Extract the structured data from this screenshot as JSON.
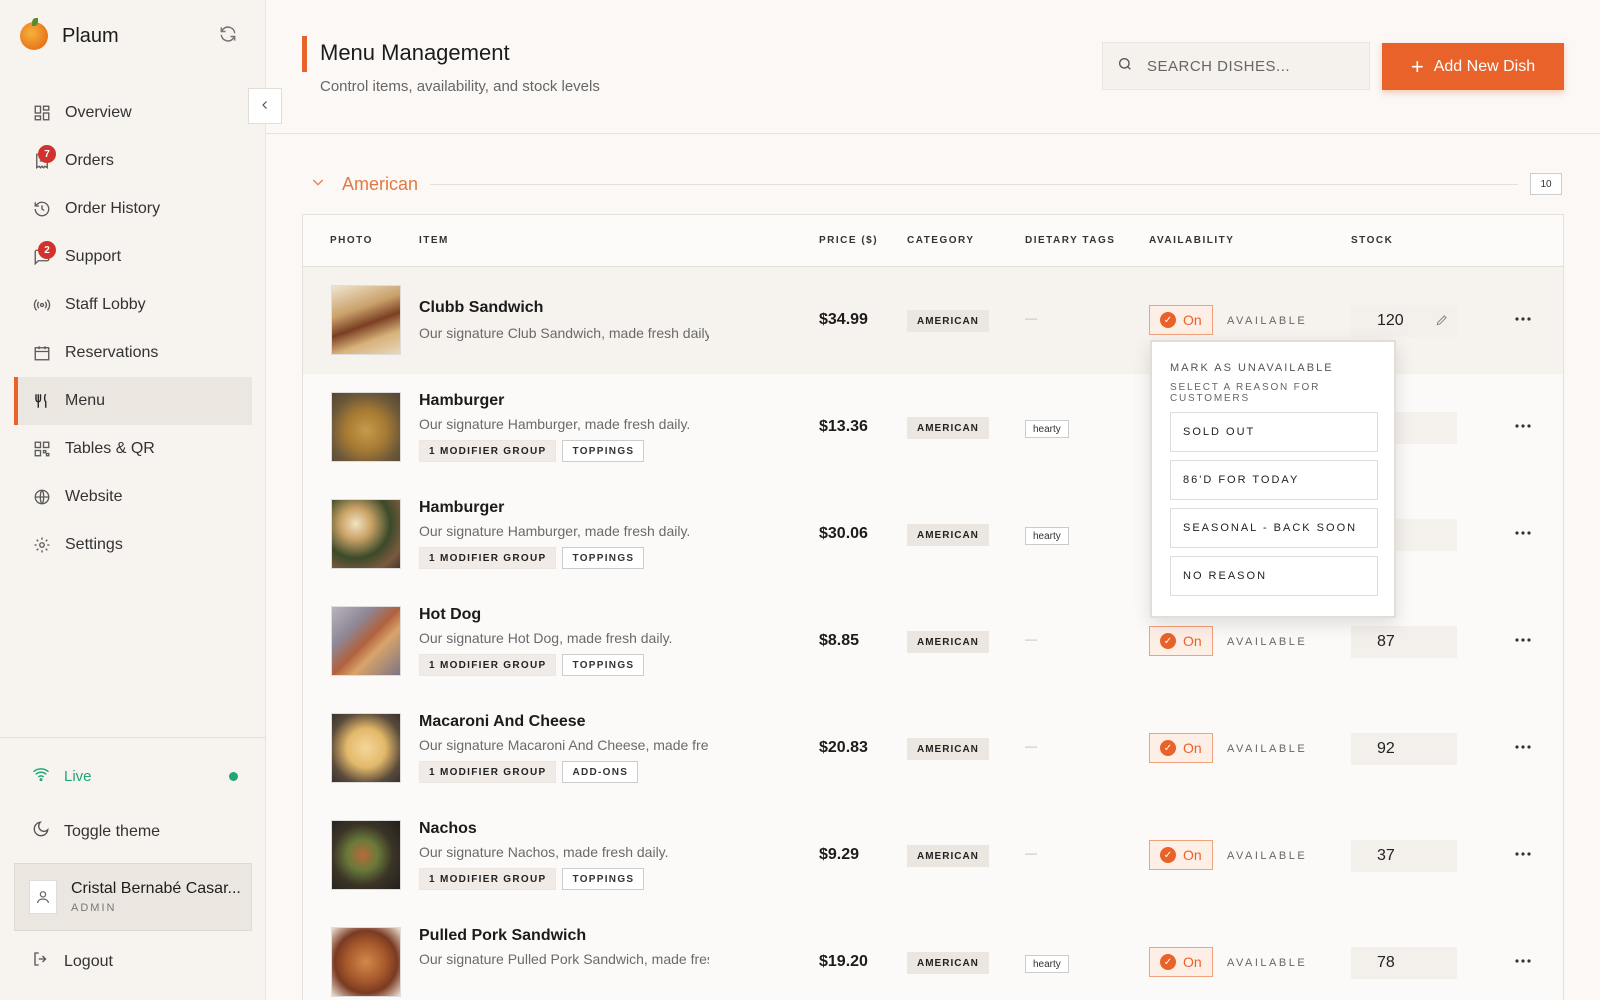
{
  "brand": {
    "name": "Plaum"
  },
  "nav": [
    {
      "label": "Overview",
      "icon": "grid-icon"
    },
    {
      "label": "Orders",
      "icon": "receipt-icon",
      "badge": "7"
    },
    {
      "label": "Order History",
      "icon": "history-icon"
    },
    {
      "label": "Support",
      "icon": "chat-icon",
      "badge": "2"
    },
    {
      "label": "Staff Lobby",
      "icon": "broadcast-icon"
    },
    {
      "label": "Reservations",
      "icon": "calendar-icon"
    },
    {
      "label": "Menu",
      "icon": "utensils-icon",
      "active": true
    },
    {
      "label": "Tables & QR",
      "icon": "qr-icon"
    },
    {
      "label": "Website",
      "icon": "globe-icon"
    },
    {
      "label": "Settings",
      "icon": "gear-icon"
    }
  ],
  "status": {
    "live_label": "Live",
    "live_color": "#1ea77a"
  },
  "theme": {
    "label": "Toggle theme"
  },
  "user": {
    "name": "Cristal Bernabé Casar...",
    "role": "ADMIN"
  },
  "logout": {
    "label": "Logout"
  },
  "header": {
    "title": "Menu Management",
    "subtitle": "Control items, availability, and stock levels",
    "search_placeholder": "SEARCH DISHES...",
    "add_button": "Add New Dish",
    "accent": "#e8622a"
  },
  "section": {
    "name": "American",
    "count": "10"
  },
  "columns": {
    "photo": "PHOTO",
    "item": "ITEM",
    "price": "PRICE ($)",
    "category": "CATEGORY",
    "dietary": "DIETARY TAGS",
    "availability": "AVAILABILITY",
    "stock": "STOCK"
  },
  "rows": [
    {
      "name": "Clubb Sandwich",
      "desc": "Our signature Club Sandwich, made fresh daily.",
      "price": "$34.99",
      "category": "AMERICAN",
      "dietary": "—",
      "toggle": "On",
      "availability": "AVAILABLE",
      "stock": "120",
      "modifiers": null,
      "addon": null
    },
    {
      "name": "Hamburger",
      "desc": "Our signature Hamburger, made fresh daily.",
      "price": "$13.36",
      "category": "AMERICAN",
      "dietary": "hearty",
      "modifiers": "1 MODIFIER GROUP",
      "addon": "TOPPINGS"
    },
    {
      "name": "Hamburger",
      "desc": "Our signature Hamburger, made fresh daily.",
      "price": "$30.06",
      "category": "AMERICAN",
      "dietary": "hearty",
      "modifiers": "1 MODIFIER GROUP",
      "addon": "TOPPINGS"
    },
    {
      "name": "Hot Dog",
      "desc": "Our signature Hot Dog, made fresh daily.",
      "price": "$8.85",
      "category": "AMERICAN",
      "dietary": "—",
      "toggle": "On",
      "availability": "AVAILABLE",
      "stock": "87",
      "modifiers": "1 MODIFIER GROUP",
      "addon": "TOPPINGS"
    },
    {
      "name": "Macaroni And Cheese",
      "desc": "Our signature Macaroni And Cheese, made fresh",
      "price": "$20.83",
      "category": "AMERICAN",
      "dietary": "—",
      "toggle": "On",
      "availability": "AVAILABLE",
      "stock": "92",
      "modifiers": "1 MODIFIER GROUP",
      "addon": "ADD-ONS"
    },
    {
      "name": "Nachos",
      "desc": "Our signature Nachos, made fresh daily.",
      "price": "$9.29",
      "category": "AMERICAN",
      "dietary": "—",
      "toggle": "On",
      "availability": "AVAILABLE",
      "stock": "37",
      "modifiers": "1 MODIFIER GROUP",
      "addon": "TOPPINGS"
    },
    {
      "name": "Pulled Pork Sandwich",
      "desc": "Our signature Pulled Pork Sandwich, made fresh d",
      "price": "$19.20",
      "category": "AMERICAN",
      "dietary": "hearty",
      "toggle": "On",
      "availability": "AVAILABLE",
      "stock": "78",
      "modifiers": null,
      "addon": null
    }
  ],
  "dropdown": {
    "title": "MARK AS UNAVAILABLE",
    "subtitle": "SELECT A REASON FOR CUSTOMERS",
    "options": [
      "SOLD OUT",
      "86'D FOR TODAY",
      "SEASONAL - BACK SOON",
      "NO REASON"
    ]
  }
}
